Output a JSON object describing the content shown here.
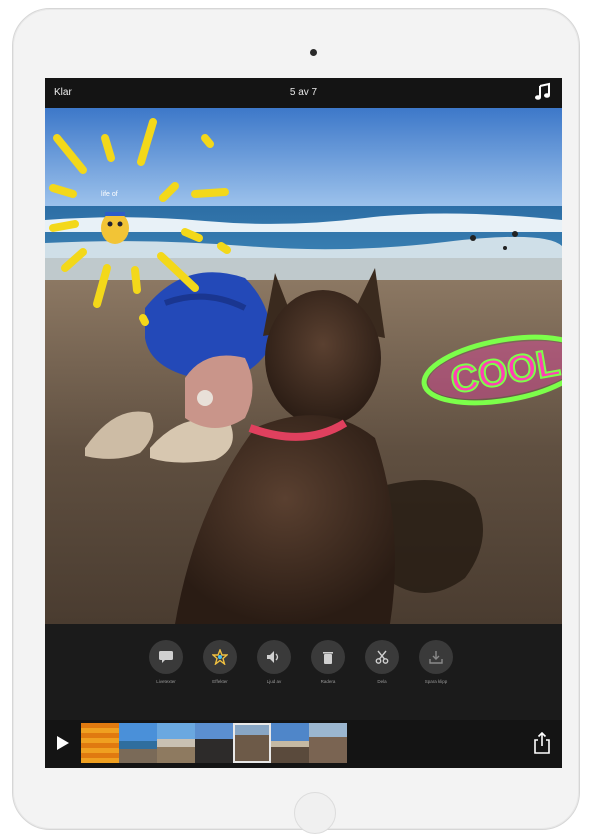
{
  "topbar": {
    "done_label": "Klar",
    "title": "5 av 7"
  },
  "photo": {
    "sticker_text": "COOL",
    "small_sticker_text": "life of"
  },
  "tools": [
    {
      "label": "Livetexter",
      "icon": "speech-bubble-icon"
    },
    {
      "label": "Effekter",
      "icon": "star-icon"
    },
    {
      "label": "Ljud av",
      "icon": "speaker-icon"
    },
    {
      "label": "Radera",
      "icon": "trash-icon"
    },
    {
      "label": "Dela",
      "icon": "scissors-icon"
    },
    {
      "label": "Spara klipp",
      "icon": "download-icon"
    }
  ],
  "timeline": {
    "clip_count": 7,
    "selected_clip": 5
  },
  "colors": {
    "screen_bg": "#141414",
    "tool_circle": "#3a3a3a",
    "sticker_green": "#7cff4a",
    "sticker_pink": "#ff3fb4"
  }
}
